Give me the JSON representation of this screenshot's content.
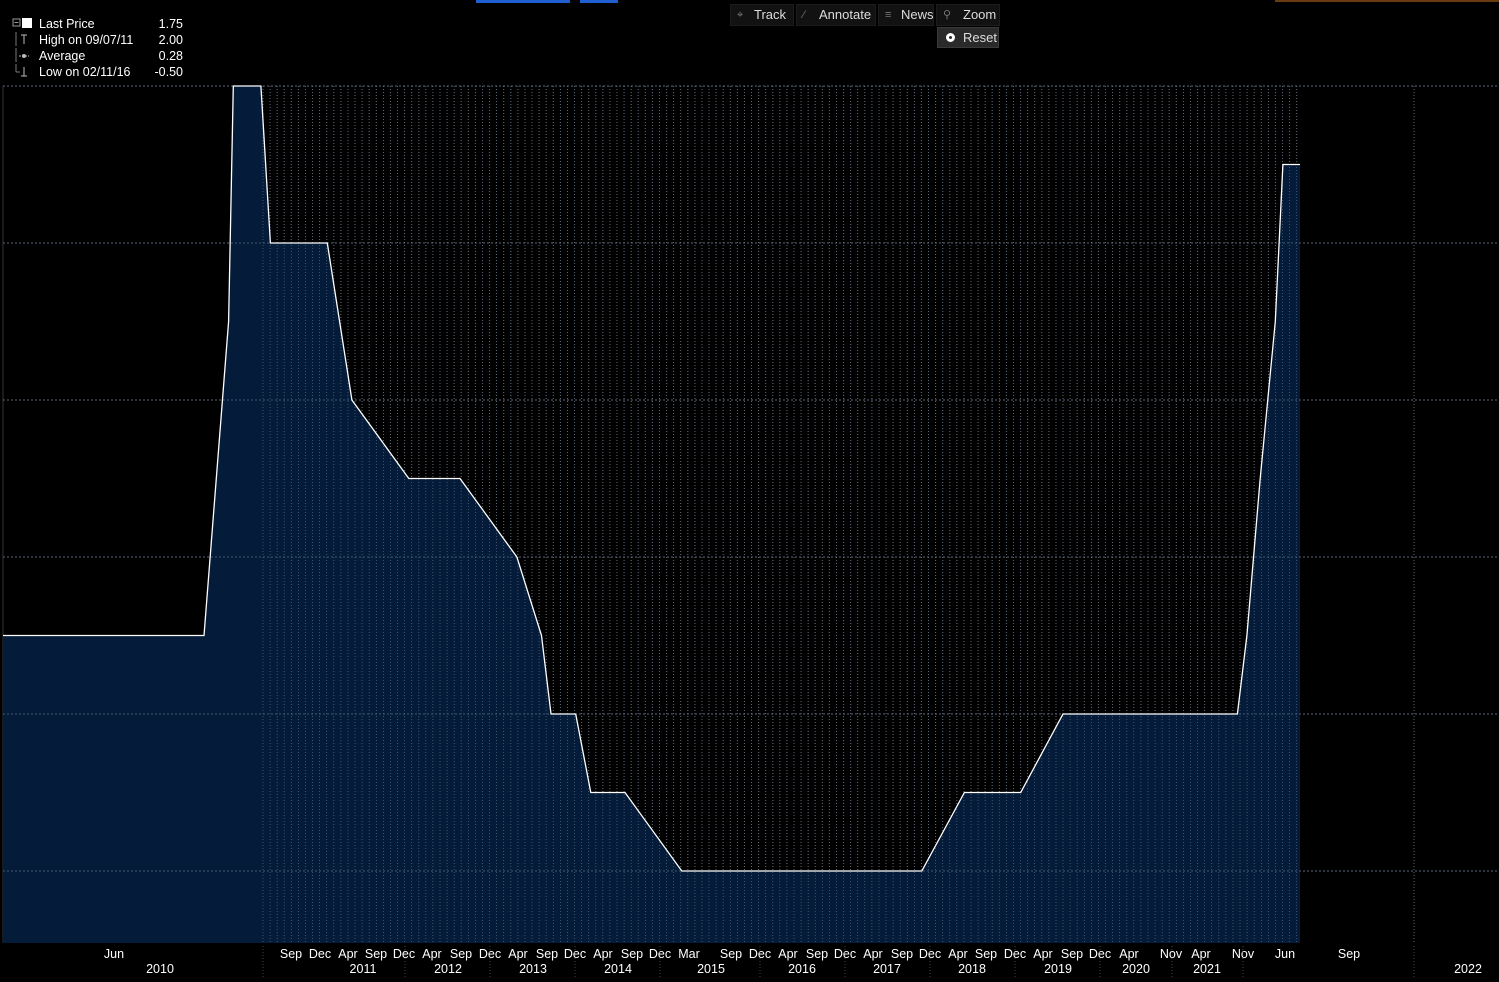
{
  "legend": {
    "rows": [
      {
        "icon": "square-icon",
        "label": "Last Price",
        "value": "1.75"
      },
      {
        "icon": "high-marker-icon",
        "label": "High on 09/07/11",
        "value": "2.00"
      },
      {
        "icon": "average-marker-icon",
        "label": "Average",
        "value": "0.28"
      },
      {
        "icon": "low-marker-icon",
        "label": "Low on 02/11/16",
        "value": "-0.50"
      }
    ]
  },
  "toolbar": {
    "track": "Track",
    "annotate": "Annotate",
    "news": "News",
    "zoom": "Zoom",
    "reset": "Reset"
  },
  "colors": {
    "background": "#000000",
    "area_fill": "#041c3c",
    "line": "#ffffff",
    "grid": "#6a6a6a",
    "top_accent": "#1f5fd0"
  },
  "chart_data": {
    "type": "area",
    "title": "",
    "xlabel": "",
    "ylabel": "",
    "ylim": [
      -0.75,
      2.25
    ],
    "grid": true,
    "x": [
      "2009-04-01",
      "2011-04-13",
      "2011-07-13",
      "2011-07-30",
      "2011-11-09",
      "2011-12-14",
      "2012-07-11",
      "2012-10-10",
      "2013-05-08",
      "2013-11-13",
      "2014-06-11",
      "2014-09-10",
      "2014-10-15",
      "2015-01-14",
      "2015-03-11",
      "2015-03-16",
      "2015-07-15",
      "2016-02-10",
      "2016-07-15",
      "2018-07-15",
      "2018-12-19",
      "2019-07-15",
      "2019-12-18",
      "2020-07-15",
      "2021-09-22",
      "2021-10-27",
      "2021-12-15",
      "2022-02-09",
      "2022-03-09",
      "2022-04-13",
      "2022-05-11"
    ],
    "values": [
      0.25,
      0.25,
      1.25,
      2.0,
      2.0,
      1.5,
      1.5,
      1.0,
      0.75,
      0.75,
      0.5,
      0.25,
      0.0,
      0.0,
      -0.25,
      -0.25,
      -0.25,
      -0.5,
      -0.5,
      -0.5,
      -0.25,
      -0.25,
      0.0,
      0.0,
      0.0,
      0.25,
      0.75,
      1.25,
      1.75,
      1.75,
      1.75
    ],
    "x_axis": {
      "month_labels": [
        {
          "label": "Jun",
          "date": "2009-06-15"
        },
        {
          "label": "Sep",
          "date": "2011-09-30"
        },
        {
          "label": "Dec",
          "date": "2011-12-31"
        },
        {
          "label": "Apr",
          "date": "2012-03-31"
        },
        {
          "label": "Sep",
          "date": "2012-06-30"
        },
        {
          "label": "Dec",
          "date": "2012-09-30"
        },
        {
          "label": "Apr",
          "date": "2012-12-31"
        },
        {
          "label": "Sep",
          "date": "2013-03-31"
        },
        {
          "label": "Dec",
          "date": "2013-06-30"
        },
        {
          "label": "Apr",
          "date": "2013-09-30"
        },
        {
          "label": "Sep",
          "date": "2013-12-31"
        },
        {
          "label": "Dec",
          "date": "2014-03-31"
        },
        {
          "label": "Apr",
          "date": "2014-06-30"
        },
        {
          "label": "Sep",
          "date": "2014-09-30"
        },
        {
          "label": "Dec",
          "date": "2014-12-31"
        },
        {
          "label": "Mar",
          "date": "2015-03-31"
        },
        {
          "label": "Sep",
          "date": "2015-09-30"
        },
        {
          "label": "Dec",
          "date": "2015-12-31"
        },
        {
          "label": "Apr",
          "date": "2016-03-31"
        },
        {
          "label": "Sep",
          "date": "2016-06-30"
        },
        {
          "label": "Dec",
          "date": "2016-09-30"
        },
        {
          "label": "Apr",
          "date": "2016-12-31"
        },
        {
          "label": "Sep",
          "date": "2017-03-31"
        },
        {
          "label": "Dec",
          "date": "2017-06-30"
        },
        {
          "label": "Apr",
          "date": "2017-09-30"
        },
        {
          "label": "Sep",
          "date": "2017-12-31"
        },
        {
          "label": "Dec",
          "date": "2018-03-31"
        },
        {
          "label": "Apr",
          "date": "2018-06-30"
        },
        {
          "label": "Sep",
          "date": "2018-09-30"
        },
        {
          "label": "Dec",
          "date": "2018-12-31"
        },
        {
          "label": "Apr",
          "date": "2019-03-31"
        },
        {
          "label": "Nov",
          "date": "2019-06-30"
        },
        {
          "label": "Apr",
          "date": "2019-09-30"
        },
        {
          "label": "Nov",
          "date": "2019-12-31"
        },
        {
          "label": "Jun",
          "date": "2020-03-31"
        },
        {
          "label": "Sep",
          "date": "2021-06-30"
        }
      ],
      "year_labels": [
        {
          "label": "2010",
          "date": "2009-11-01"
        },
        {
          "label": "2011",
          "date": "2011-05-15"
        },
        {
          "label": "2012",
          "date": "2012-05-15"
        },
        {
          "label": "2013",
          "date": "2013-05-15"
        },
        {
          "label": "2014",
          "date": "2014-05-15"
        },
        {
          "label": "2015",
          "date": "2015-05-15"
        },
        {
          "label": "2016",
          "date": "2016-05-15"
        },
        {
          "label": "2017",
          "date": "2017-05-15"
        },
        {
          "label": "2018",
          "date": "2018-05-15"
        },
        {
          "label": "2019",
          "date": "2019-05-15"
        },
        {
          "label": "2020",
          "date": "2020-05-15"
        },
        {
          "label": "2021",
          "date": "2021-05-15"
        },
        {
          "label": "2022",
          "date": "2023-06-15"
        }
      ]
    }
  }
}
